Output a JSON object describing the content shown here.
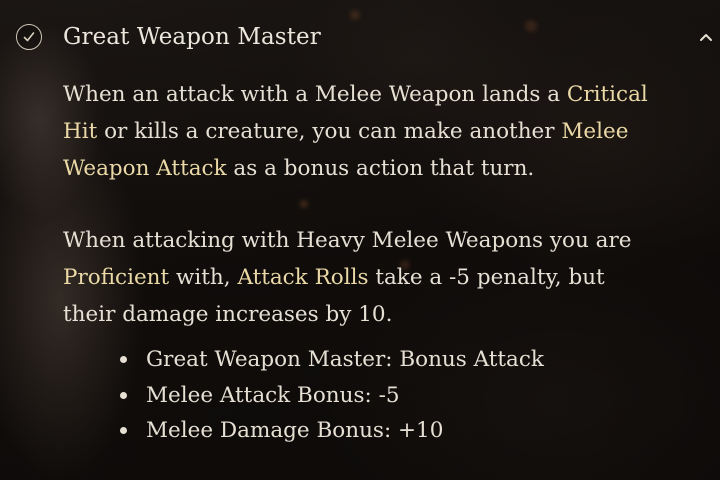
{
  "tooltip": {
    "title": "Great Weapon Master",
    "paragraph1": {
      "t1": "When an attack with a Melee Weapon lands a ",
      "k1": "Critical Hit",
      "t2": " or kills a creature, you can make another ",
      "k2": "Melee Weapon Attack",
      "t3": " as a bonus action that turn."
    },
    "paragraph2": {
      "t1": "When attacking with Heavy Melee Weapons you are ",
      "k1": "Proficient",
      "t2": " with, ",
      "k2": "Attack Rolls",
      "t3": " take a -5 penalty, but their damage increases by 10."
    },
    "bullets": [
      "Great Weapon Master: Bonus Attack",
      "Melee Attack Bonus: -5",
      "Melee Damage Bonus: +10"
    ]
  },
  "colors": {
    "keyword": "#ead9a6",
    "text": "#e6dfd3",
    "background": "#15110f"
  },
  "icons": {
    "status": "checkmark-circle-icon",
    "collapse": "chevron-up-icon"
  }
}
